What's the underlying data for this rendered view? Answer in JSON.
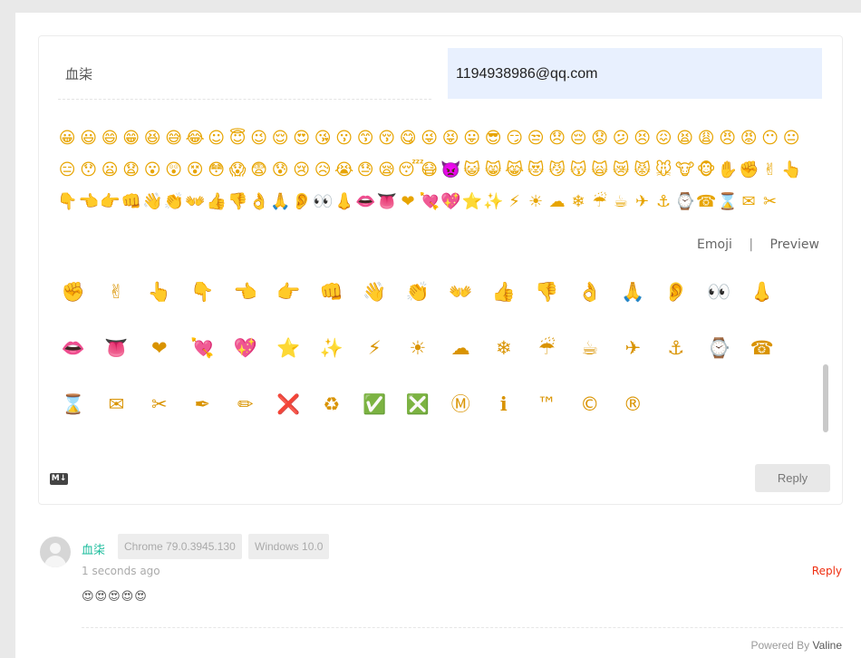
{
  "form": {
    "nick_value": "血柒",
    "email_value": "1194938986@qq.com"
  },
  "emoji_strip": {
    "rows": [
      [
        "😀",
        "😃",
        "😄",
        "😁",
        "😆",
        "😅",
        "😂",
        "☺",
        "😇",
        "😉",
        "😌",
        "😍",
        "😘",
        "😗",
        "😙",
        "😚",
        "😋",
        "😜",
        "😝",
        "😛",
        "😎",
        "😏",
        "😒",
        "😞",
        "😔",
        "😟",
        "😕",
        "😣",
        "😖",
        "😫",
        "😩",
        "😠",
        "😡",
        "😶",
        "😐"
      ],
      [
        "😑",
        "😯",
        "😦",
        "😧",
        "😮",
        "😲",
        "😵",
        "😳",
        "😱",
        "😨",
        "😰",
        "😢",
        "😥",
        "😭",
        "😓",
        "😪",
        "😴",
        "😷",
        "👿",
        "😺",
        "😸",
        "😹",
        "😻",
        "😼",
        "😽",
        "🙀",
        "😿",
        "😾",
        "🐭",
        "🐮",
        "🐵",
        "✋",
        "✊",
        "✌",
        "👆"
      ],
      [
        "👇",
        "👈",
        "👉",
        "👊",
        "👋",
        "👏",
        "👐",
        "👍",
        "👎",
        "👌",
        "🙏",
        "👂",
        "👀",
        "👃",
        "👄",
        "👅",
        "❤",
        "💘",
        "💖",
        "⭐",
        "✨",
        "⚡",
        "☀",
        "☁",
        "❄",
        "☔",
        "☕",
        "✈",
        "⚓",
        "⌚",
        "☎",
        "⌛",
        "✉",
        "✂"
      ]
    ]
  },
  "tabs": {
    "emoji_label": "Emoji",
    "separator": "|",
    "preview_label": "Preview"
  },
  "picker": {
    "rows": [
      [
        "✊",
        "✌",
        "👆",
        "👇",
        "👈",
        "👉",
        "👊",
        "👋",
        "👏",
        "👐",
        "👍",
        "👎",
        "👌",
        "🙏",
        "👂",
        "👀",
        "👃"
      ],
      [
        "👄",
        "👅",
        "❤",
        "💘",
        "💖",
        "⭐",
        "✨",
        "⚡",
        "☀",
        "☁",
        "❄",
        "☔",
        "☕",
        "✈",
        "⚓",
        "⌚",
        "☎"
      ],
      [
        "⌛",
        "✉",
        "✂",
        "✒",
        "✏",
        "❌",
        "♻",
        "✅",
        "❎",
        "Ⓜ",
        "ℹ",
        "™",
        "©",
        "®"
      ]
    ]
  },
  "toolbar": {
    "markdown_icon_text": "M↓",
    "reply_label": "Reply"
  },
  "comment": {
    "nick": "血柒",
    "browser": "Chrome 79.0.3945.130",
    "os": "Windows 10.0",
    "time": "1 seconds ago",
    "reply_label": "Reply",
    "content": "😍😍😍😍😍"
  },
  "footer": {
    "powered_by": "Powered By",
    "brand": "Valine"
  }
}
